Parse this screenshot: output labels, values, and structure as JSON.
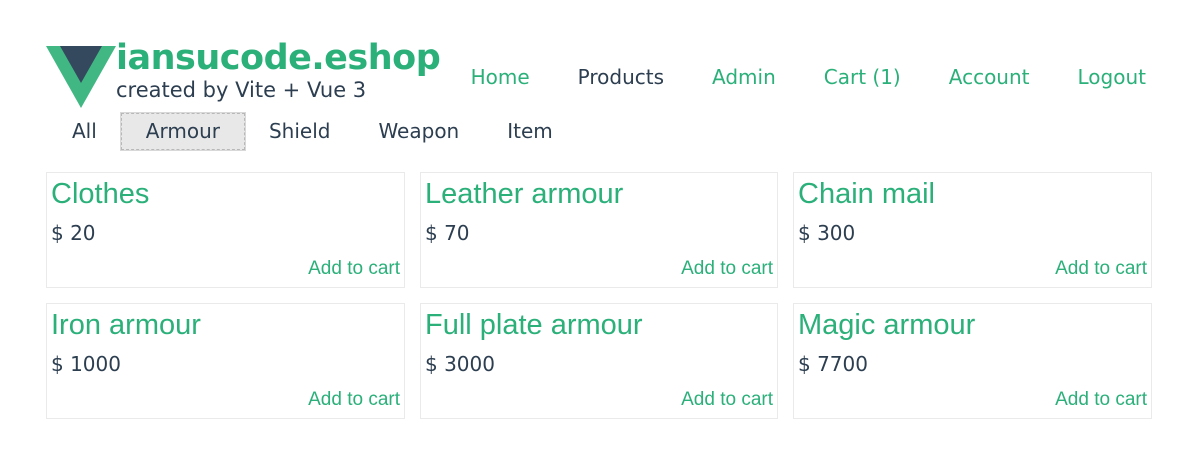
{
  "brand": {
    "title": "iansucode.eshop",
    "subtitle": "created by Vite + Vue 3",
    "logo_icon": "vue-logo-icon",
    "colors": {
      "green": "#41b883",
      "dark": "#34495e"
    }
  },
  "nav": {
    "items": [
      {
        "label": "Home"
      },
      {
        "label": "Products"
      },
      {
        "label": "Admin"
      },
      {
        "label": "Cart (1)"
      },
      {
        "label": "Account"
      },
      {
        "label": "Logout"
      }
    ],
    "active": "Products"
  },
  "filters": {
    "items": [
      {
        "label": "All"
      },
      {
        "label": "Armour"
      },
      {
        "label": "Shield"
      },
      {
        "label": "Weapon"
      },
      {
        "label": "Item"
      }
    ],
    "selected": "Armour"
  },
  "products": [
    {
      "name": "Clothes",
      "price": "$ 20",
      "action": "Add to cart"
    },
    {
      "name": "Leather armour",
      "price": "$ 70",
      "action": "Add to cart"
    },
    {
      "name": "Chain mail",
      "price": "$ 300",
      "action": "Add to cart"
    },
    {
      "name": "Iron armour",
      "price": "$ 1000",
      "action": "Add to cart"
    },
    {
      "name": "Full plate armour",
      "price": "$ 3000",
      "action": "Add to cart"
    },
    {
      "name": "Magic armour",
      "price": "$ 7700",
      "action": "Add to cart"
    }
  ],
  "theme": {
    "accent": "#2bb07a",
    "text": "#2c3e50",
    "selected_bg": "#e8e8e8",
    "card_border": "#eaeaea"
  }
}
